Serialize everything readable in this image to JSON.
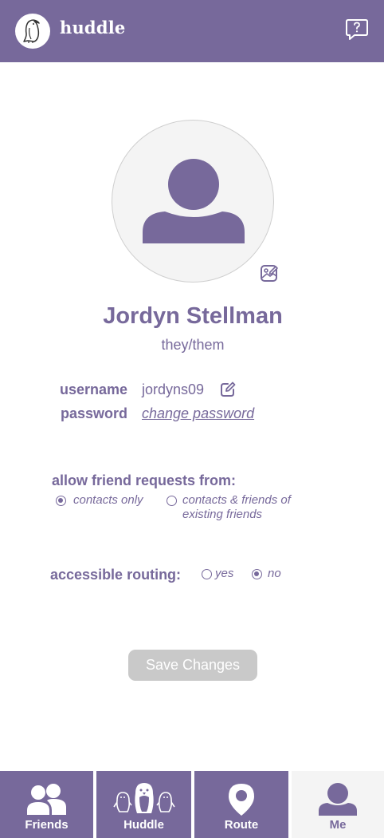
{
  "header": {
    "app_name": "huddle"
  },
  "profile": {
    "name": "Jordyn Stellman",
    "pronouns": "they/them"
  },
  "account": {
    "username_label": "username",
    "username_value": "jordyns09",
    "password_label": "password",
    "password_link": "change password"
  },
  "friend_requests": {
    "label": "allow friend requests from:",
    "options": [
      {
        "label": "contacts only",
        "selected": true
      },
      {
        "label_line1": "contacts & friends of",
        "label_line2": "existing friends",
        "selected": false
      }
    ]
  },
  "accessible_routing": {
    "label": "accessible routing:",
    "options": [
      {
        "label": "yes",
        "selected": false
      },
      {
        "label": "no",
        "selected": true
      }
    ]
  },
  "save_button": "Save Changes",
  "nav": {
    "items": [
      {
        "label": "Friends",
        "active": false
      },
      {
        "label": "Huddle",
        "active": false
      },
      {
        "label": "Route",
        "active": false
      },
      {
        "label": "Me",
        "active": true
      }
    ]
  },
  "colors": {
    "brand": "#77699b",
    "disabled_button": "#c9c9c9",
    "avatar_bg": "#f4f4f4"
  },
  "icons": {
    "logo": "penguin-icon",
    "help": "help-bubble-icon",
    "edit_photo": "edit-photo-icon",
    "edit_username": "edit-icon",
    "friends": "friends-icon",
    "huddle": "penguins-icon",
    "route": "location-pin-icon",
    "me": "person-icon"
  }
}
